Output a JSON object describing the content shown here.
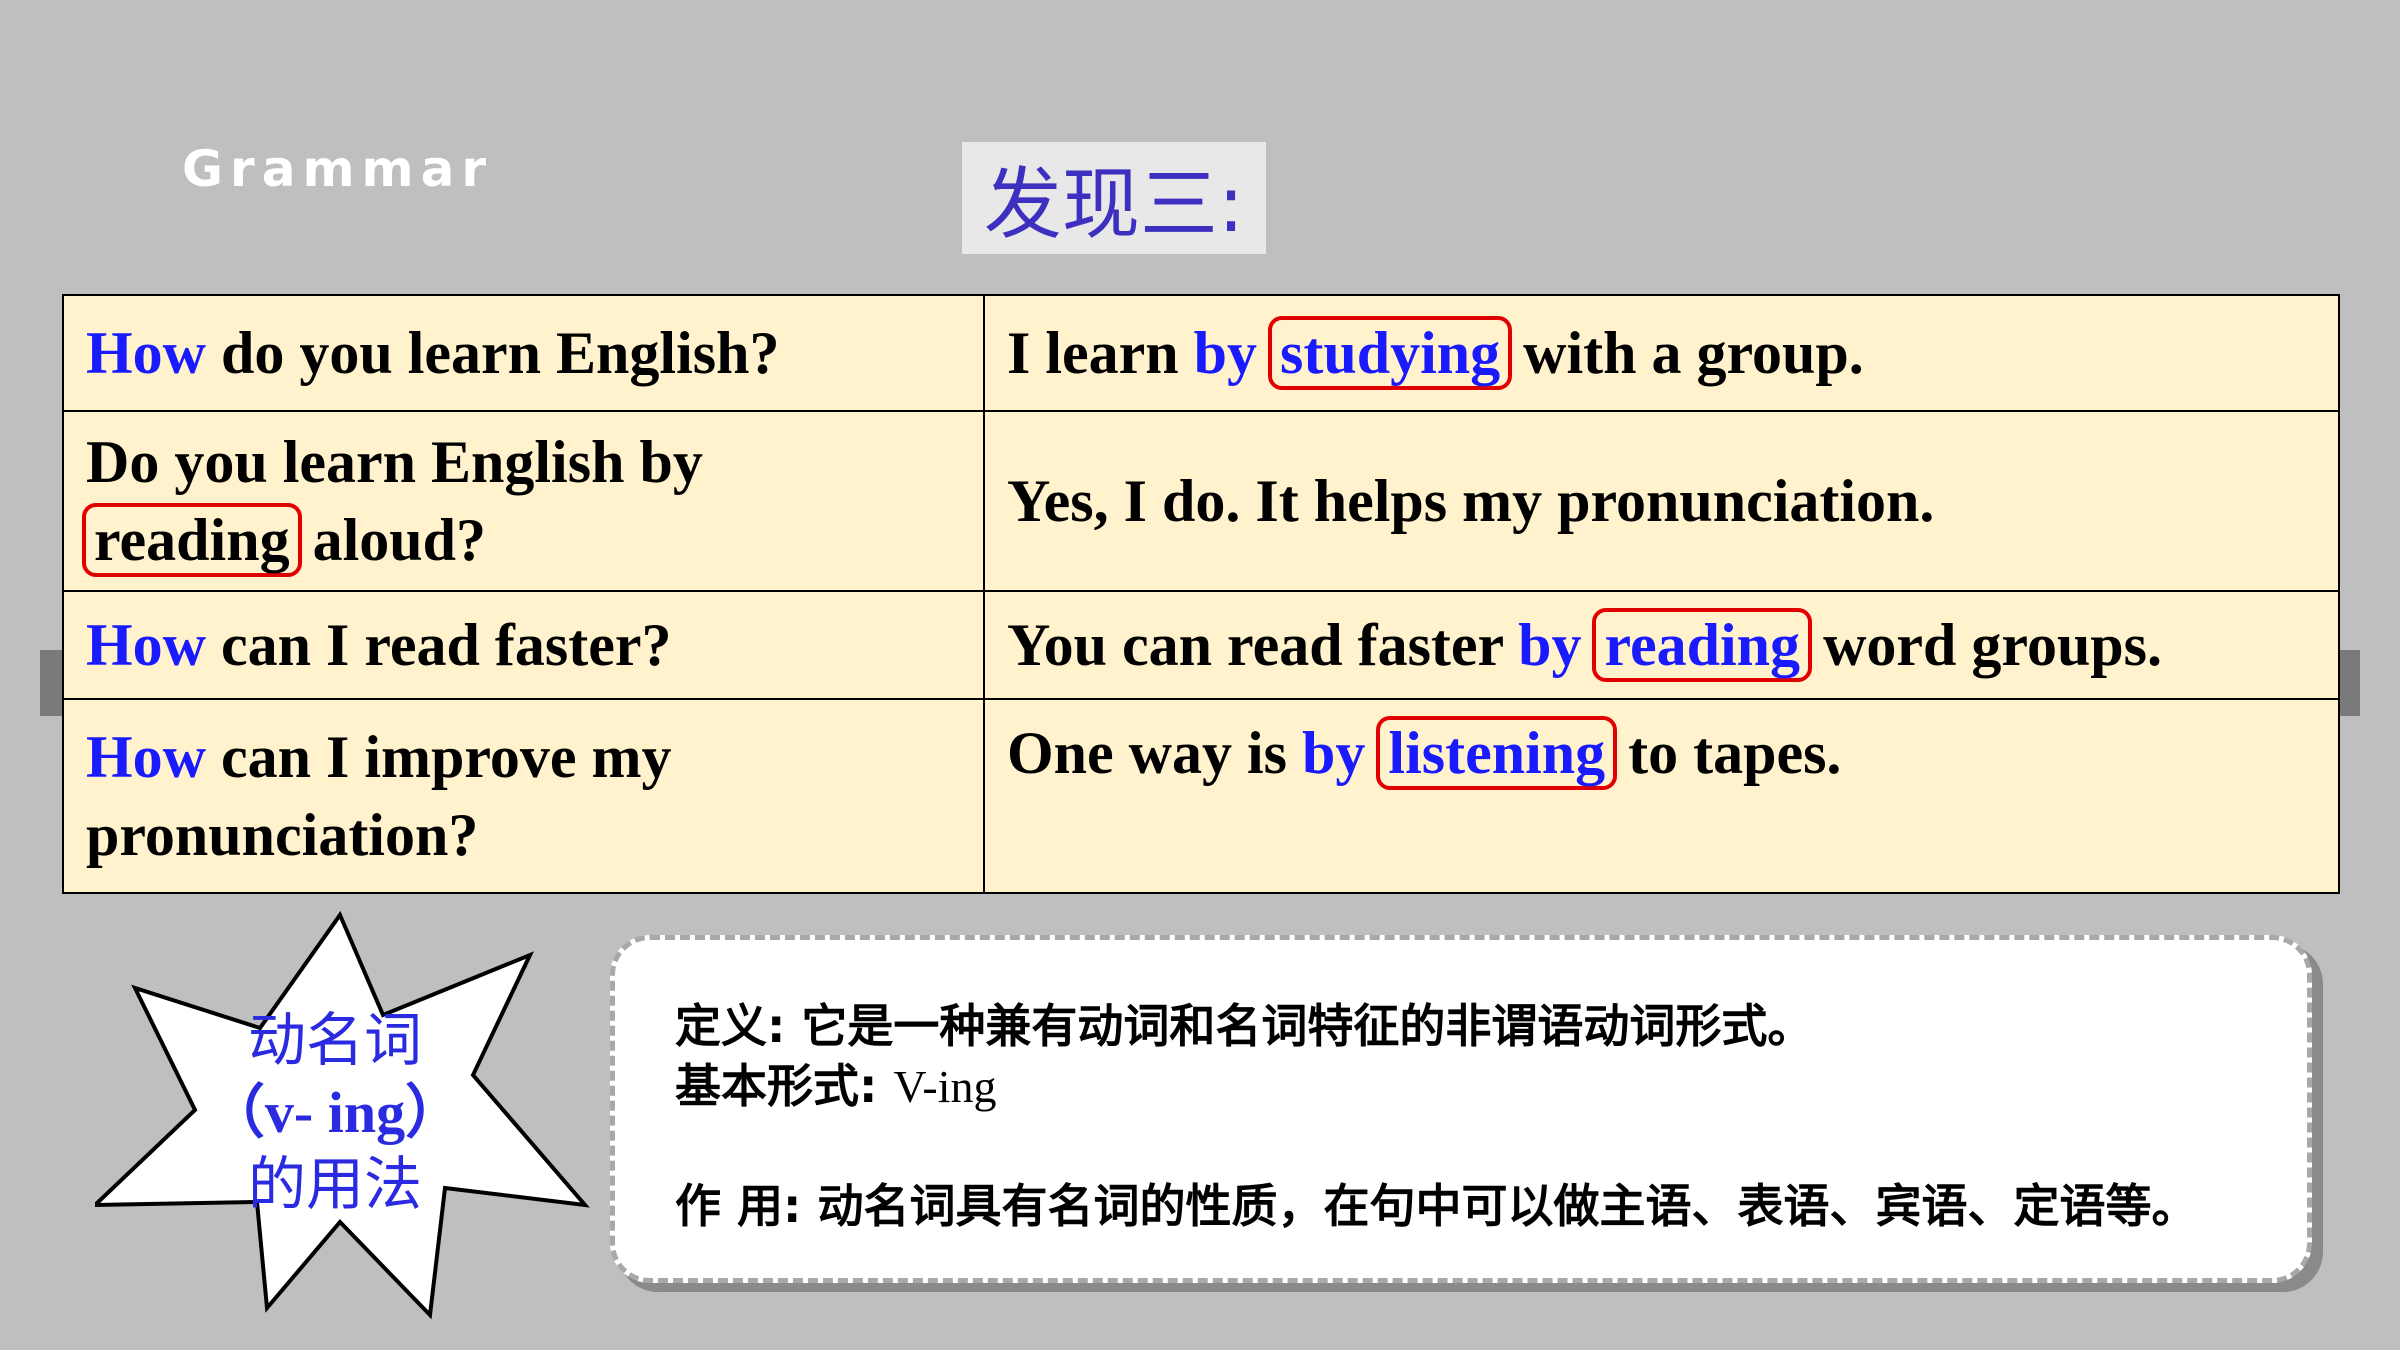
{
  "header": {
    "section_label": "Grammar",
    "title": "发现三:"
  },
  "table": {
    "rows": [
      {
        "q": {
          "h": "How",
          "t": " do you learn English?"
        },
        "a": {
          "t1": "I learn ",
          "by": "by",
          "box": "studying",
          "t2": " with a group."
        }
      },
      {
        "q": {
          "t1": "Do you learn English by",
          "box": "reading",
          "t2": " aloud?"
        },
        "a": {
          "t": "Yes, I do. It helps my pronunciation."
        }
      },
      {
        "q": {
          "h": "How",
          "t": " can I read faster?"
        },
        "a": {
          "t1": "You can read faster ",
          "by": "by",
          "box": "reading",
          "t2": " word groups."
        }
      },
      {
        "q": {
          "h": "How",
          "t1": " can I improve my",
          "t2": "pronunciation?"
        },
        "a": {
          "t1": "One way is ",
          "by": "by",
          "box": "listening",
          "t2": " to tapes."
        }
      }
    ]
  },
  "burst": {
    "line1": "动名词",
    "line2": "（v- ing）",
    "line3": "的用法"
  },
  "note": {
    "def_label": "定义: ",
    "def_text": "它是一种兼有动词和名词特征的非谓语动词形式。",
    "form_label": "基本形式: ",
    "form_text": "V-ing",
    "use_label": "作 用: ",
    "use_text": "动名词具有名词的性质，在句中可以做主语、表语、宾语、定语等。"
  },
  "colors": {
    "highlight": "#1a1aff",
    "box": "#e00000",
    "table_bg": "#fff2cc",
    "title": "#3d2fc0"
  }
}
